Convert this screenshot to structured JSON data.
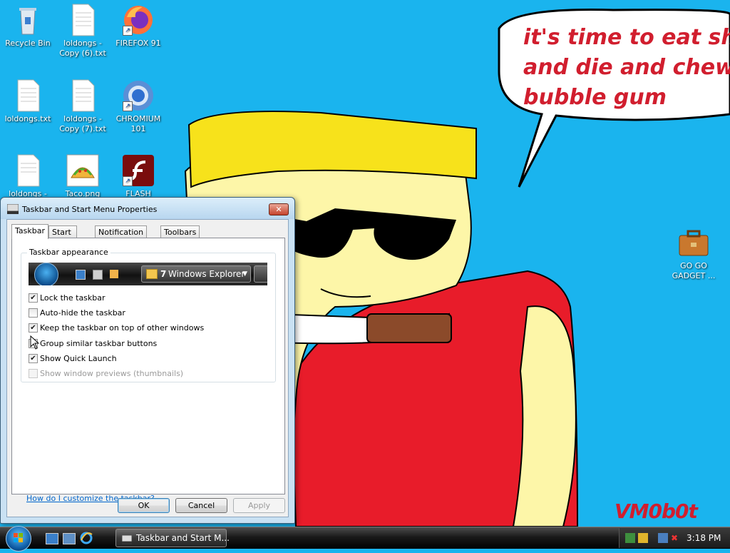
{
  "desktop": {
    "icons": [
      {
        "label": "Recycle Bin",
        "icon": "recycle-bin-icon"
      },
      {
        "label": "loldongs - Copy (6).txt",
        "icon": "text-file-icon"
      },
      {
        "label": "FIREFOX 91",
        "icon": "firefox-icon"
      },
      {
        "label": "loldongs.txt",
        "icon": "text-file-icon"
      },
      {
        "label": "loldongs - Copy (7).txt",
        "icon": "text-file-icon"
      },
      {
        "label": "CHROMIUM 101",
        "icon": "chromium-icon"
      },
      {
        "label": "loldongs -",
        "icon": "text-file-icon"
      },
      {
        "label": "Taco.png",
        "icon": "image-file-icon"
      },
      {
        "label": "FLASH",
        "icon": "flash-icon"
      },
      {
        "label": "GO GO GADGET ...",
        "icon": "briefcase-icon"
      }
    ],
    "wallpaper": {
      "speech_lines": [
        "it's time to eat shit",
        "and die and chew",
        "bubble gum"
      ],
      "signature": "VM0b0t",
      "colors": {
        "sky": "#1ab4ee",
        "text_red": "#d11e2e",
        "hat": "#f7e21b",
        "skin": "#fdf6a8",
        "shirt": "#e81c2a"
      }
    }
  },
  "dialog": {
    "title": "Taskbar and Start Menu Properties",
    "close": "✕",
    "tabs": [
      "Taskbar",
      "Start Menu",
      "Notification Area",
      "Toolbars"
    ],
    "active_tab": "Taskbar",
    "group_title": "Taskbar appearance",
    "preview": {
      "count": "7",
      "label": "Windows Explorer"
    },
    "options": [
      {
        "label": "Lock the taskbar",
        "checked": true,
        "enabled": true
      },
      {
        "label": "Auto-hide the taskbar",
        "checked": false,
        "enabled": true
      },
      {
        "label": "Keep the taskbar on top of other windows",
        "checked": true,
        "enabled": true
      },
      {
        "label": "Group similar taskbar buttons",
        "checked": false,
        "enabled": true
      },
      {
        "label": "Show Quick Launch",
        "checked": true,
        "enabled": true
      },
      {
        "label": "Show window previews (thumbnails)",
        "checked": false,
        "enabled": false
      }
    ],
    "help_link": "How do I customize the taskbar?",
    "buttons": {
      "ok": "OK",
      "cancel": "Cancel",
      "apply": "Apply"
    }
  },
  "taskbar": {
    "active_window": "Taskbar and Start M...",
    "clock": "3:18 PM",
    "quick_launch": [
      "show-desktop-icon",
      "switch-windows-icon",
      "internet-explorer-icon"
    ],
    "tray_icons": [
      "network-icon",
      "security-alert-icon",
      "network-status-icon",
      "volume-muted-icon"
    ]
  }
}
